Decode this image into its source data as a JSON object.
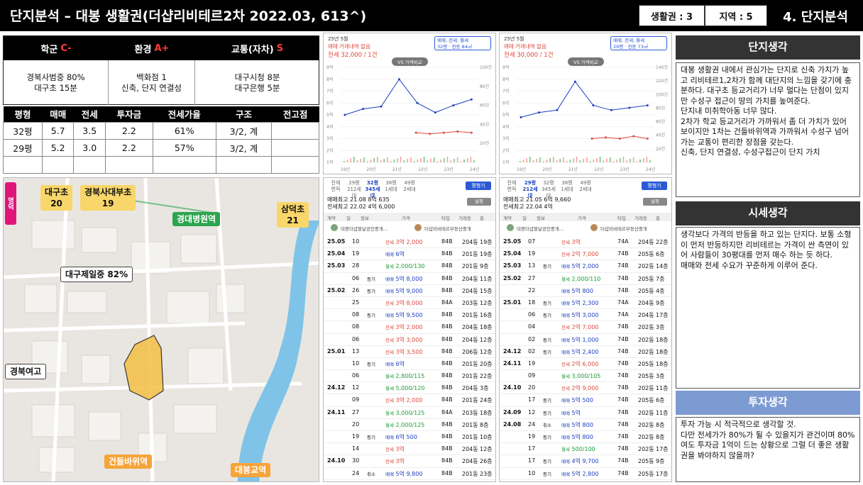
{
  "header": {
    "title": "단지분석 – 대봉 생활권(더샵리비테르2차 2022.03, 613^)",
    "box1": "생활권 : 3",
    "box2": "지역  : 5",
    "section": "4. 단지분석"
  },
  "grades": [
    {
      "label": "학군",
      "grade": "C-",
      "lines": [
        "경북사범중 80%",
        "대구초 15분"
      ]
    },
    {
      "label": "환경",
      "grade": "A+",
      "lines": [
        "백화점 1",
        "신축, 단지 연결성"
      ]
    },
    {
      "label": "교통(자차)",
      "grade": "S",
      "lines": [
        "대구시청 8분",
        "대구은행 5분"
      ]
    }
  ],
  "price_table": {
    "headers": [
      "평형",
      "매매",
      "전세",
      "투자금",
      "전세가율",
      "구조",
      "전고점"
    ],
    "rows": [
      [
        "32평",
        "5.7",
        "3.5",
        "2.2",
        "61%",
        "3/2, 계",
        ""
      ],
      [
        "29평",
        "5.2",
        "3.0",
        "2.2",
        "57%",
        "3/2, 계",
        ""
      ],
      [
        "",
        "",
        "",
        "",
        "",
        "",
        ""
      ]
    ]
  },
  "map": {
    "labels": {
      "daegu_elem": "대구초\n20",
      "kyungpook_affil": "경북사대부초\n19",
      "kyungdae_hosp": "경대병원역",
      "samdeok": "삼덕초\n21",
      "daegu_je_il": "대구제일중 82%",
      "kyungbuk_girls": "경북여고",
      "kondeulbawi": "건들바위역",
      "daebong_bridge": "대봉교역",
      "side_tag": "명덕"
    }
  },
  "charts": [
    {
      "date": "25년 5월",
      "subtitle": "매매 거래내역 없음",
      "jeonse": "전세 32,000 / 1건",
      "badge_line1": "매매, 전세, 월세",
      "badge_line2": "32평 · 전용 84㎡",
      "vs": "VS 가격비교",
      "y_left": [
        "9억",
        "8억",
        "7억",
        "6억",
        "5억",
        "4억",
        "3억",
        "2억",
        "1억"
      ],
      "y_right": [
        "100건",
        "80건",
        "60건",
        "40건",
        "20건"
      ],
      "x_labels": [
        "19년",
        "20년",
        "21년",
        "22년",
        "23년",
        "24년"
      ]
    },
    {
      "date": "25년 5월",
      "subtitle": "매매 거래내역 없음",
      "jeonse": "전세 30,000 / 1건",
      "badge_line1": "매매, 전세, 월세",
      "badge_line2": "29평 · 전용 73㎡",
      "vs": "VS 가격비교",
      "y_left": [
        "9억",
        "8억",
        "7억",
        "6억",
        "5억",
        "4억",
        "3억",
        "2억",
        "1억"
      ],
      "y_right": [
        "140건",
        "120건",
        "100건",
        "80건",
        "60건",
        "40건",
        "20건"
      ],
      "x_labels": [
        "19년",
        "20년",
        "21년",
        "22년",
        "23년",
        "24년"
      ]
    }
  ],
  "chart_data": [
    {
      "type": "line",
      "title": "",
      "x": [
        "19년",
        "20년",
        "21년",
        "22년",
        "23년",
        "24년"
      ],
      "series": [
        {
          "name": "매매",
          "values": [
            5.0,
            5.5,
            5.7,
            8.0,
            6.0,
            5.2,
            5.8,
            6.3
          ]
        },
        {
          "name": "전세",
          "values": [
            3.5,
            3.4,
            3.5,
            3.6,
            3.5
          ]
        }
      ],
      "ylim": [
        1,
        9
      ]
    },
    {
      "type": "line",
      "title": "",
      "x": [
        "19년",
        "20년",
        "21년",
        "22년",
        "23년",
        "24년"
      ],
      "series": [
        {
          "name": "매매",
          "values": [
            4.8,
            5.2,
            5.4,
            7.8,
            5.8,
            5.4,
            5.6,
            5.8
          ]
        },
        {
          "name": "전세",
          "values": [
            3.0,
            3.1,
            3.0,
            3.2,
            3.0
          ]
        }
      ],
      "ylim": [
        1,
        9
      ]
    }
  ],
  "listings": [
    {
      "tabs": [
        {
          "l1": "전체",
          "l2": "면적"
        },
        {
          "l1": "29평",
          "l2": "212세대"
        },
        {
          "l1": "32평",
          "l2": "345세대"
        },
        {
          "l1": "38평",
          "l2": "1세대"
        },
        {
          "l1": "49평",
          "l2": "2세대"
        }
      ],
      "btn": "평형기",
      "btn2": "설정",
      "max1": "매매최고 21.08 8억 635",
      "max2": "전세최고 22.02 4억 6,000",
      "hdr": [
        "계약",
        "일",
        "정보",
        "가격",
        "타입",
        "거래동",
        "층"
      ],
      "agent1": "대봉더샵블날공인중개...",
      "agent2": "더샵리비테르부동산중개",
      "rows": [
        {
          "d": "25.05",
          "day": "10",
          "info": "",
          "pt": "전세",
          "p": "3억 2,000",
          "c": "r",
          "a": "84B",
          "dong": "204동",
          "f": "19층"
        },
        {
          "d": "25.04",
          "day": "19",
          "info": "",
          "pt": "매매",
          "p": "6억",
          "c": "b",
          "a": "84B",
          "dong": "201동",
          "f": "19층"
        },
        {
          "d": "25.03",
          "day": "28",
          "info": "",
          "pt": "월세",
          "p": "2,000/130",
          "c": "g",
          "a": "84B",
          "dong": "201동",
          "f": "9층"
        },
        {
          "d": "",
          "day": "06",
          "info": "등기",
          "pt": "매매",
          "p": "5억 8,000",
          "c": "b",
          "a": "84B",
          "dong": "204동",
          "f": "11층"
        },
        {
          "d": "25.02",
          "day": "26",
          "info": "등기",
          "pt": "매매",
          "p": "5억 9,000",
          "c": "b",
          "a": "84B",
          "dong": "204동",
          "f": "15층"
        },
        {
          "d": "",
          "day": "25",
          "info": "",
          "pt": "전세",
          "p": "3억 8,000",
          "c": "r",
          "a": "84A",
          "dong": "203동",
          "f": "12층"
        },
        {
          "d": "",
          "day": "08",
          "info": "등기",
          "pt": "매매",
          "p": "5억 9,500",
          "c": "b",
          "a": "84B",
          "dong": "201동",
          "f": "16층"
        },
        {
          "d": "",
          "day": "08",
          "info": "",
          "pt": "전세",
          "p": "3억 2,000",
          "c": "r",
          "a": "84B",
          "dong": "204동",
          "f": "18층"
        },
        {
          "d": "",
          "day": "06",
          "info": "",
          "pt": "전세",
          "p": "3억 3,000",
          "c": "r",
          "a": "84B",
          "dong": "204동",
          "f": "12층"
        },
        {
          "d": "25.01",
          "day": "13",
          "info": "",
          "pt": "전세",
          "p": "3억 3,500",
          "c": "r",
          "a": "84B",
          "dong": "206동",
          "f": "12층"
        },
        {
          "d": "",
          "day": "10",
          "info": "등기",
          "pt": "매매",
          "p": "6억",
          "c": "b",
          "a": "84B",
          "dong": "201동",
          "f": "20층"
        },
        {
          "d": "",
          "day": "06",
          "info": "",
          "pt": "월세",
          "p": "2,800/115",
          "c": "g",
          "a": "84B",
          "dong": "201동",
          "f": "22층"
        },
        {
          "d": "24.12",
          "day": "12",
          "info": "",
          "pt": "월세",
          "p": "5,000/120",
          "c": "g",
          "a": "84B",
          "dong": "204동",
          "f": "3층"
        },
        {
          "d": "",
          "day": "09",
          "info": "",
          "pt": "전세",
          "p": "3억 2,000",
          "c": "r",
          "a": "84B",
          "dong": "201동",
          "f": "24층"
        },
        {
          "d": "24.11",
          "day": "27",
          "info": "",
          "pt": "월세",
          "p": "3,000/125",
          "c": "g",
          "a": "84A",
          "dong": "203동",
          "f": "18층"
        },
        {
          "d": "",
          "day": "20",
          "info": "",
          "pt": "월세",
          "p": "2,000/125",
          "c": "g",
          "a": "84B",
          "dong": "201동",
          "f": "8층"
        },
        {
          "d": "",
          "day": "19",
          "info": "등기",
          "pt": "매매",
          "p": "6억 500",
          "c": "b",
          "a": "84B",
          "dong": "201동",
          "f": "10층"
        },
        {
          "d": "",
          "day": "14",
          "info": "",
          "pt": "전세",
          "p": "3억",
          "c": "r",
          "a": "84B",
          "dong": "204동",
          "f": "12층"
        },
        {
          "d": "24.10",
          "day": "30",
          "info": "",
          "pt": "전세",
          "p": "3억",
          "c": "r",
          "a": "84B",
          "dong": "204동",
          "f": "26층"
        },
        {
          "d": "",
          "day": "24",
          "info": "취소",
          "pt": "매매",
          "p": "5억 9,800",
          "c": "b",
          "a": "84B",
          "dong": "201동",
          "f": "23층"
        }
      ]
    },
    {
      "tabs": [
        {
          "l1": "전체",
          "l2": "면적"
        },
        {
          "l1": "29평",
          "l2": "212세대"
        },
        {
          "l1": "32평",
          "l2": "345세대"
        },
        {
          "l1": "38평",
          "l2": "1세대"
        },
        {
          "l1": "49평",
          "l2": "2세대"
        }
      ],
      "btn": "평형기",
      "btn2": "설정",
      "max1": "매매최고 21.05 6억 9,660",
      "max2": "전세최고 22.04 4억",
      "hdr": [
        "계약",
        "일",
        "정보",
        "가격",
        "타입",
        "거래동",
        "층"
      ],
      "agent1": "대봉더샵블날공인중개...",
      "agent2": "더샵리비테르부동산중개",
      "rows": [
        {
          "d": "25.05",
          "day": "07",
          "info": "",
          "pt": "전세",
          "p": "3억",
          "c": "r",
          "a": "74A",
          "dong": "204동",
          "f": "22층"
        },
        {
          "d": "25.04",
          "day": "19",
          "info": "",
          "pt": "전세",
          "p": "2억 7,000",
          "c": "r",
          "a": "74B",
          "dong": "205동",
          "f": "6층"
        },
        {
          "d": "25.03",
          "day": "13",
          "info": "등기",
          "pt": "매매",
          "p": "5억 2,000",
          "c": "b",
          "a": "74B",
          "dong": "202동",
          "f": "14층"
        },
        {
          "d": "25.02",
          "day": "27",
          "info": "",
          "pt": "월세",
          "p": "2,000/110",
          "c": "g",
          "a": "74B",
          "dong": "205동",
          "f": "7층"
        },
        {
          "d": "",
          "day": "22",
          "info": "",
          "pt": "매매",
          "p": "5억 800",
          "c": "b",
          "a": "74B",
          "dong": "205동",
          "f": "4층"
        },
        {
          "d": "25.01",
          "day": "18",
          "info": "등기",
          "pt": "매매",
          "p": "5억 2,300",
          "c": "b",
          "a": "74A",
          "dong": "204동",
          "f": "9층"
        },
        {
          "d": "",
          "day": "06",
          "info": "등기",
          "pt": "매매",
          "p": "5억 3,000",
          "c": "b",
          "a": "74A",
          "dong": "204동",
          "f": "17층"
        },
        {
          "d": "",
          "day": "04",
          "info": "",
          "pt": "전세",
          "p": "2억 7,000",
          "c": "r",
          "a": "74B",
          "dong": "202동",
          "f": "3층"
        },
        {
          "d": "",
          "day": "02",
          "info": "등기",
          "pt": "매매",
          "p": "5억 1,000",
          "c": "b",
          "a": "74B",
          "dong": "202동",
          "f": "18층"
        },
        {
          "d": "24.12",
          "day": "02",
          "info": "등기",
          "pt": "매매",
          "p": "5억 2,400",
          "c": "b",
          "a": "74B",
          "dong": "202동",
          "f": "18층"
        },
        {
          "d": "24.11",
          "day": "19",
          "info": "",
          "pt": "전세",
          "p": "2억 6,000",
          "c": "r",
          "a": "74B",
          "dong": "205동",
          "f": "18층"
        },
        {
          "d": "",
          "day": "09",
          "info": "",
          "pt": "월세",
          "p": "3,000/105",
          "c": "g",
          "a": "74B",
          "dong": "205동",
          "f": "3층"
        },
        {
          "d": "24.10",
          "day": "20",
          "info": "",
          "pt": "전세",
          "p": "2억 9,000",
          "c": "r",
          "a": "74B",
          "dong": "202동",
          "f": "11층"
        },
        {
          "d": "",
          "day": "17",
          "info": "등기",
          "pt": "매매",
          "p": "5억 500",
          "c": "b",
          "a": "74B",
          "dong": "205동",
          "f": "6층"
        },
        {
          "d": "24.09",
          "day": "12",
          "info": "등기",
          "pt": "매매",
          "p": "5억",
          "c": "b",
          "a": "74B",
          "dong": "202동",
          "f": "11층"
        },
        {
          "d": "24.08",
          "day": "24",
          "info": "취소",
          "pt": "매매",
          "p": "5억 800",
          "c": "b",
          "a": "74B",
          "dong": "202동",
          "f": "8층"
        },
        {
          "d": "",
          "day": "19",
          "info": "등기",
          "pt": "매매",
          "p": "5억 800",
          "c": "b",
          "a": "74B",
          "dong": "202동",
          "f": "8층"
        },
        {
          "d": "",
          "day": "17",
          "info": "",
          "pt": "월세",
          "p": "500/100",
          "c": "g",
          "a": "74B",
          "dong": "202동",
          "f": "17층"
        },
        {
          "d": "",
          "day": "17",
          "info": "등기",
          "pt": "매매",
          "p": "4억 9,700",
          "c": "b",
          "a": "74B",
          "dong": "205동",
          "f": "9층"
        },
        {
          "d": "",
          "day": "10",
          "info": "등기",
          "pt": "매매",
          "p": "5억 2,800",
          "c": "b",
          "a": "74B",
          "dong": "205동",
          "f": "17층"
        }
      ]
    }
  ],
  "panels": {
    "danji_title": "단지생각",
    "danji_text": "대봉 생활권 내에서 관심가는 단지로 신축 가치가 높고 리비테르1,2차가 함께 대단지의 느낌을 갖기에 충분하다. 대구초 등교거리가 너무 멀다는 단점이 있지만 수성구 접근이 땅의 가치를 높여준다.\n단지내 미취학아동 너무 많다.\n2차가 학교 등교거리가 가까워서 좀 더 가치가 있어 보이지만 1차는 건들바위역과 가까워서 수성구 넘어가는 교통이 편리한 장점을 갖는다.\n신축, 단지 연결성, 수성구접근이 단지 가치",
    "sise_title": "시세생각",
    "sise_text": "생각보다 가격의 반등을 하고 있는 단지다. 보통 소형이 먼저 반등하지만 리비테르는 가격이 싼 측면이 있어 사람들이 30평대를 먼저 매수 하는 듯 하다.\n매매와 전세 수요가 꾸준하게 이루어 준다.",
    "invest_title": "투자생각",
    "invest_text": "투자 가능 시 적극적으로 생각할 것.\n다만 전세가가 80%가 될 수 있을지가 관건이며 80%여도 투자금 1억이 드는 상황으로 그럴 더 좋은 생활권을 봐야하지 않을까?"
  },
  "colors": {
    "accent_blue": "#2b59d6",
    "sale": "#1a3fc0",
    "jeonse": "#e0473b",
    "rent": "#1c9e37",
    "header": "#000000"
  }
}
